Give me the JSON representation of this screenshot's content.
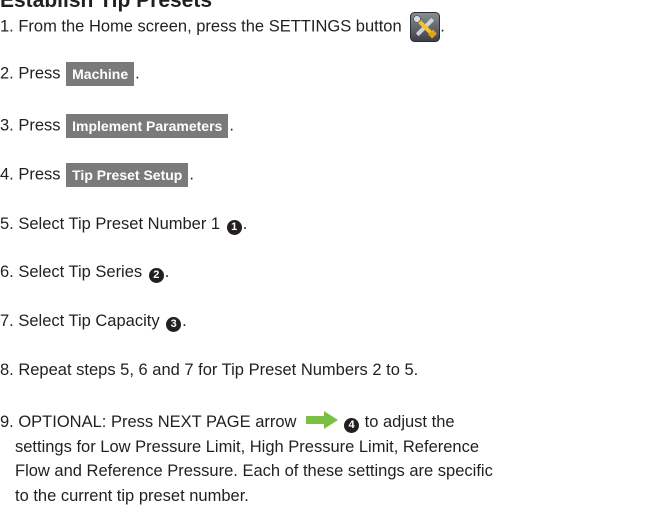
{
  "heading": "Establish Tip Presets",
  "steps": {
    "s1": {
      "text": "1. From the Home screen, press the SETTINGS button",
      "end": "."
    },
    "s2": {
      "pre": "2. Press",
      "button": "Machine",
      "end": "."
    },
    "s3": {
      "pre": "3. Press",
      "button": "Implement Parameters",
      "end": "."
    },
    "s4": {
      "pre": "4. Press",
      "button": "Tip Preset Setup",
      "end": "."
    },
    "s5": {
      "pre": "5. Select Tip Preset Number 1",
      "marker": "1",
      "end": "."
    },
    "s6": {
      "pre": "6. Select Tip Series",
      "marker": "2",
      "end": "."
    },
    "s7": {
      "pre": "7. Select Tip Capacity",
      "marker": "3",
      "end": "."
    },
    "s8": {
      "text": "8. Repeat steps 5, 6 and 7 for Tip Preset Numbers 2 to 5."
    },
    "s9": {
      "pre": "9. OPTIONAL: Press NEXT PAGE arrow",
      "marker": "4",
      "post": " to adjust the",
      "line2": "settings for Low Pressure Limit, High Pressure Limit, Reference",
      "line3": "Flow and Reference Pressure. Each of these settings are specific",
      "line4": "to the current tip preset number."
    }
  },
  "icons": {
    "settings": "settings-tools-icon",
    "next_page": "next-page-arrow-icon"
  },
  "colors": {
    "button_bg": "#7b7a7a",
    "text": "#231f20",
    "arrow": "#7ac143"
  }
}
